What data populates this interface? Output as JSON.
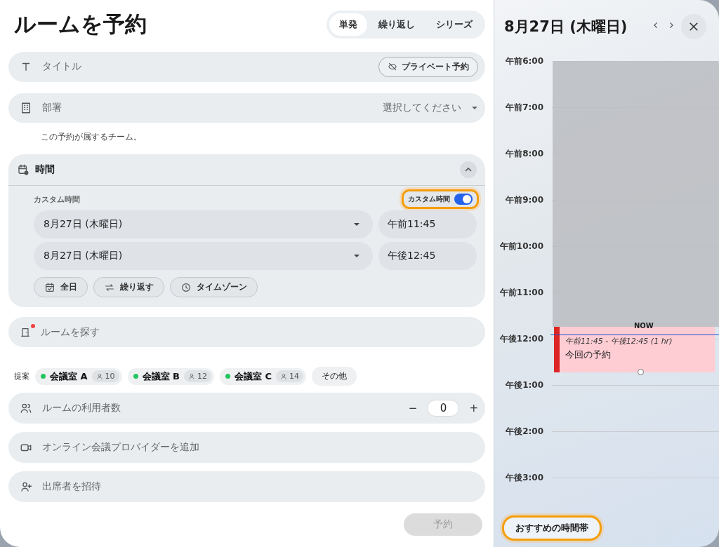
{
  "title": "ルームを予約",
  "mode_tabs": [
    {
      "label": "単発",
      "selected": true
    },
    {
      "label": "繰り返し",
      "selected": false
    },
    {
      "label": "シリーズ",
      "selected": false
    }
  ],
  "title_field": {
    "placeholder": "タイトル",
    "private_button": "プライベート予約"
  },
  "department": {
    "label": "部署",
    "value": "選択してください",
    "hint": "この予約が属するチーム。"
  },
  "time_section": {
    "heading": "時間",
    "expanded": true,
    "custom_label": "カスタム時間",
    "custom_toggle": {
      "label": "カスタム時間",
      "on": true,
      "focused": true
    },
    "start": {
      "date": "8月27日 (木曜日)",
      "time": "午前11:45"
    },
    "end": {
      "date": "8月27日 (木曜日)",
      "time": "午後12:45"
    },
    "actions": [
      {
        "kind": "allday",
        "label": "全日"
      },
      {
        "kind": "repeat",
        "label": "繰り返す"
      },
      {
        "kind": "timezone",
        "label": "タイムゾーン"
      }
    ]
  },
  "room_search": {
    "placeholder": "ルームを探す",
    "required": true
  },
  "suggestions": {
    "label": "提案",
    "rooms": [
      {
        "name": "会議室 A",
        "capacity": "10",
        "color": "#22c55e"
      },
      {
        "name": "会議室 B",
        "capacity": "12",
        "color": "#22c55e"
      },
      {
        "name": "会議室 C",
        "capacity": "14",
        "color": "#22c55e"
      }
    ],
    "more": "その他"
  },
  "occupancy": {
    "label": "ルームの利用者数",
    "minus": "−",
    "value": "0",
    "plus": "+"
  },
  "online_meeting": {
    "placeholder": "オンライン会議プロバイダーを追加"
  },
  "invite": {
    "placeholder": "出席者を招待"
  },
  "submit": {
    "label": "予約",
    "disabled": true
  },
  "calendar": {
    "date": "8月27日 (木曜日)",
    "hours": [
      "午前6:00",
      "午前7:00",
      "午前8:00",
      "午前9:00",
      "午前10:00",
      "午前11:00",
      "午後12:00",
      "午後1:00",
      "午後2:00",
      "午後3:00"
    ],
    "event": {
      "time": "午前11:45 - 午後12:45 (1 hr)",
      "title": "今回の予約"
    },
    "now_label": "NOW",
    "suggest_button": {
      "label": "おすすめの時間帯",
      "focused": true
    }
  }
}
